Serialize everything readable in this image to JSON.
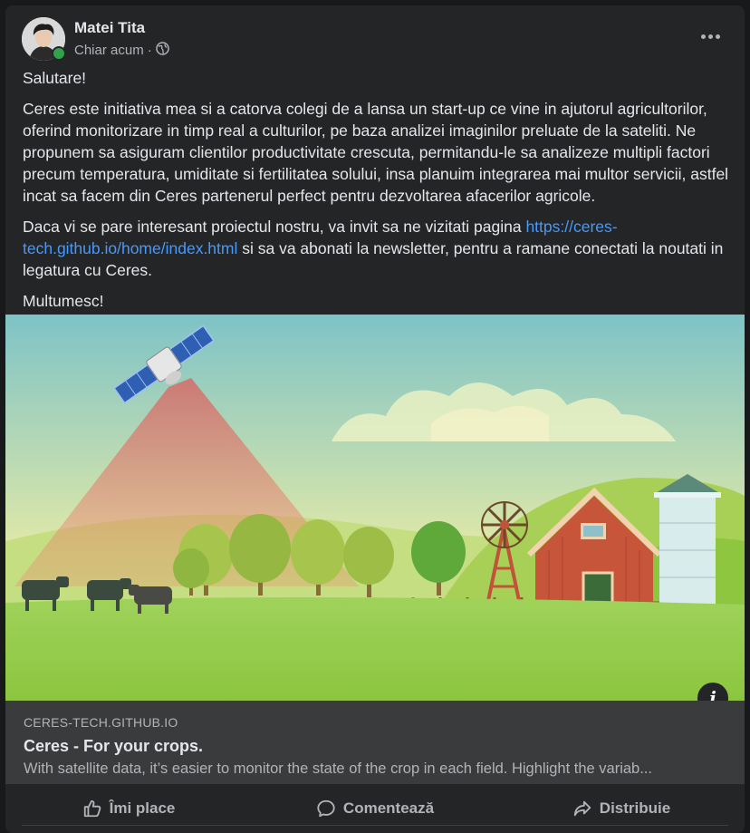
{
  "post": {
    "author": "Matei Tita",
    "time": "Chiar acum",
    "separator": "·",
    "privacy_icon": "globe-icon",
    "more_icon": "more-horizontal-icon",
    "body": {
      "greeting": "Salutare!",
      "paragraph1": "Ceres este initiativa mea si a catorva colegi de a lansa un start-up ce vine in ajutorul agricultorilor, oferind monitorizare in timp real a culturilor, pe baza analizei imaginilor preluate de la sateliti. Ne propunem sa asiguram clientilor productivitate crescuta, permitandu-le sa analizeze multipli factori precum temperatura, umiditate si fertilitatea solului, insa planuim integrarea mai multor servicii, astfel incat sa facem din Ceres partenerul perfect pentru dezvoltarea afacerilor agricole.",
      "paragraph2_before": "Daca vi se pare interesant proiectul nostru, va invit sa ne vizitati pagina ",
      "paragraph2_link": "https://ceres-tech.github.io/home/index.html",
      "paragraph2_after": " si sa va abonati la newsletter, pentru a ramane conectati la noutati in legatura cu Ceres.",
      "closing": "Multumesc!"
    },
    "link_preview": {
      "domain": "CERES-TECH.GITHUB.IO",
      "title": "Ceres - For your crops.",
      "description": "With satellite data, it’s easier to monitor the state of the crop in each field. Highlight the variab...",
      "info_label": "i"
    },
    "actions": {
      "like": "Îmi place",
      "comment": "Comentează",
      "share": "Distribuie"
    }
  },
  "colors": {
    "background": "#18191a",
    "card": "#242526",
    "link": "#4599ff",
    "online": "#31a24c"
  }
}
